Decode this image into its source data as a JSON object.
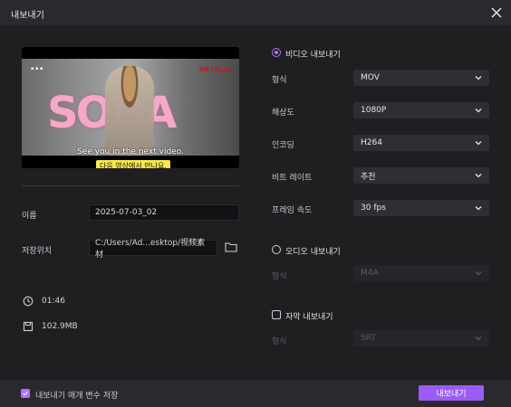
{
  "dialog": {
    "title": "내보내기"
  },
  "preview": {
    "overlay_title": "SODA",
    "brand": "NETFLIX",
    "subtitle_en": "See you in the next video.",
    "subtitle_ko": "다음 영상에서 만나요."
  },
  "left": {
    "name_label": "이름",
    "name_value": "2025-07-03_02",
    "path_label": "저장위치",
    "path_value": "C:/Users/Ad...esktop/视频素材",
    "duration": "01:46",
    "size": "102.9MB"
  },
  "video_export": {
    "label": "비디오 내보내기",
    "selected": true,
    "rows": [
      {
        "label": "형식",
        "value": "MOV"
      },
      {
        "label": "해상도",
        "value": "1080P"
      },
      {
        "label": "인코딩",
        "value": "H264"
      },
      {
        "label": "비트 레이트",
        "value": "추천"
      },
      {
        "label": "프레임 속도",
        "value": "30  fps"
      }
    ]
  },
  "audio_export": {
    "label": "오디오 내보내기",
    "selected": false,
    "format_label": "형식",
    "format_value": "M4A"
  },
  "subtitle_export": {
    "label": "자막 내보내기",
    "checked": false,
    "format_label": "형식",
    "format_value": "SRT"
  },
  "footer": {
    "save_params_label": "내보내기 매개 변수 저장",
    "save_params_checked": true,
    "export_button": "내보내기"
  },
  "colors": {
    "accent": "#9b5cf6",
    "background": "#1f1f22"
  }
}
